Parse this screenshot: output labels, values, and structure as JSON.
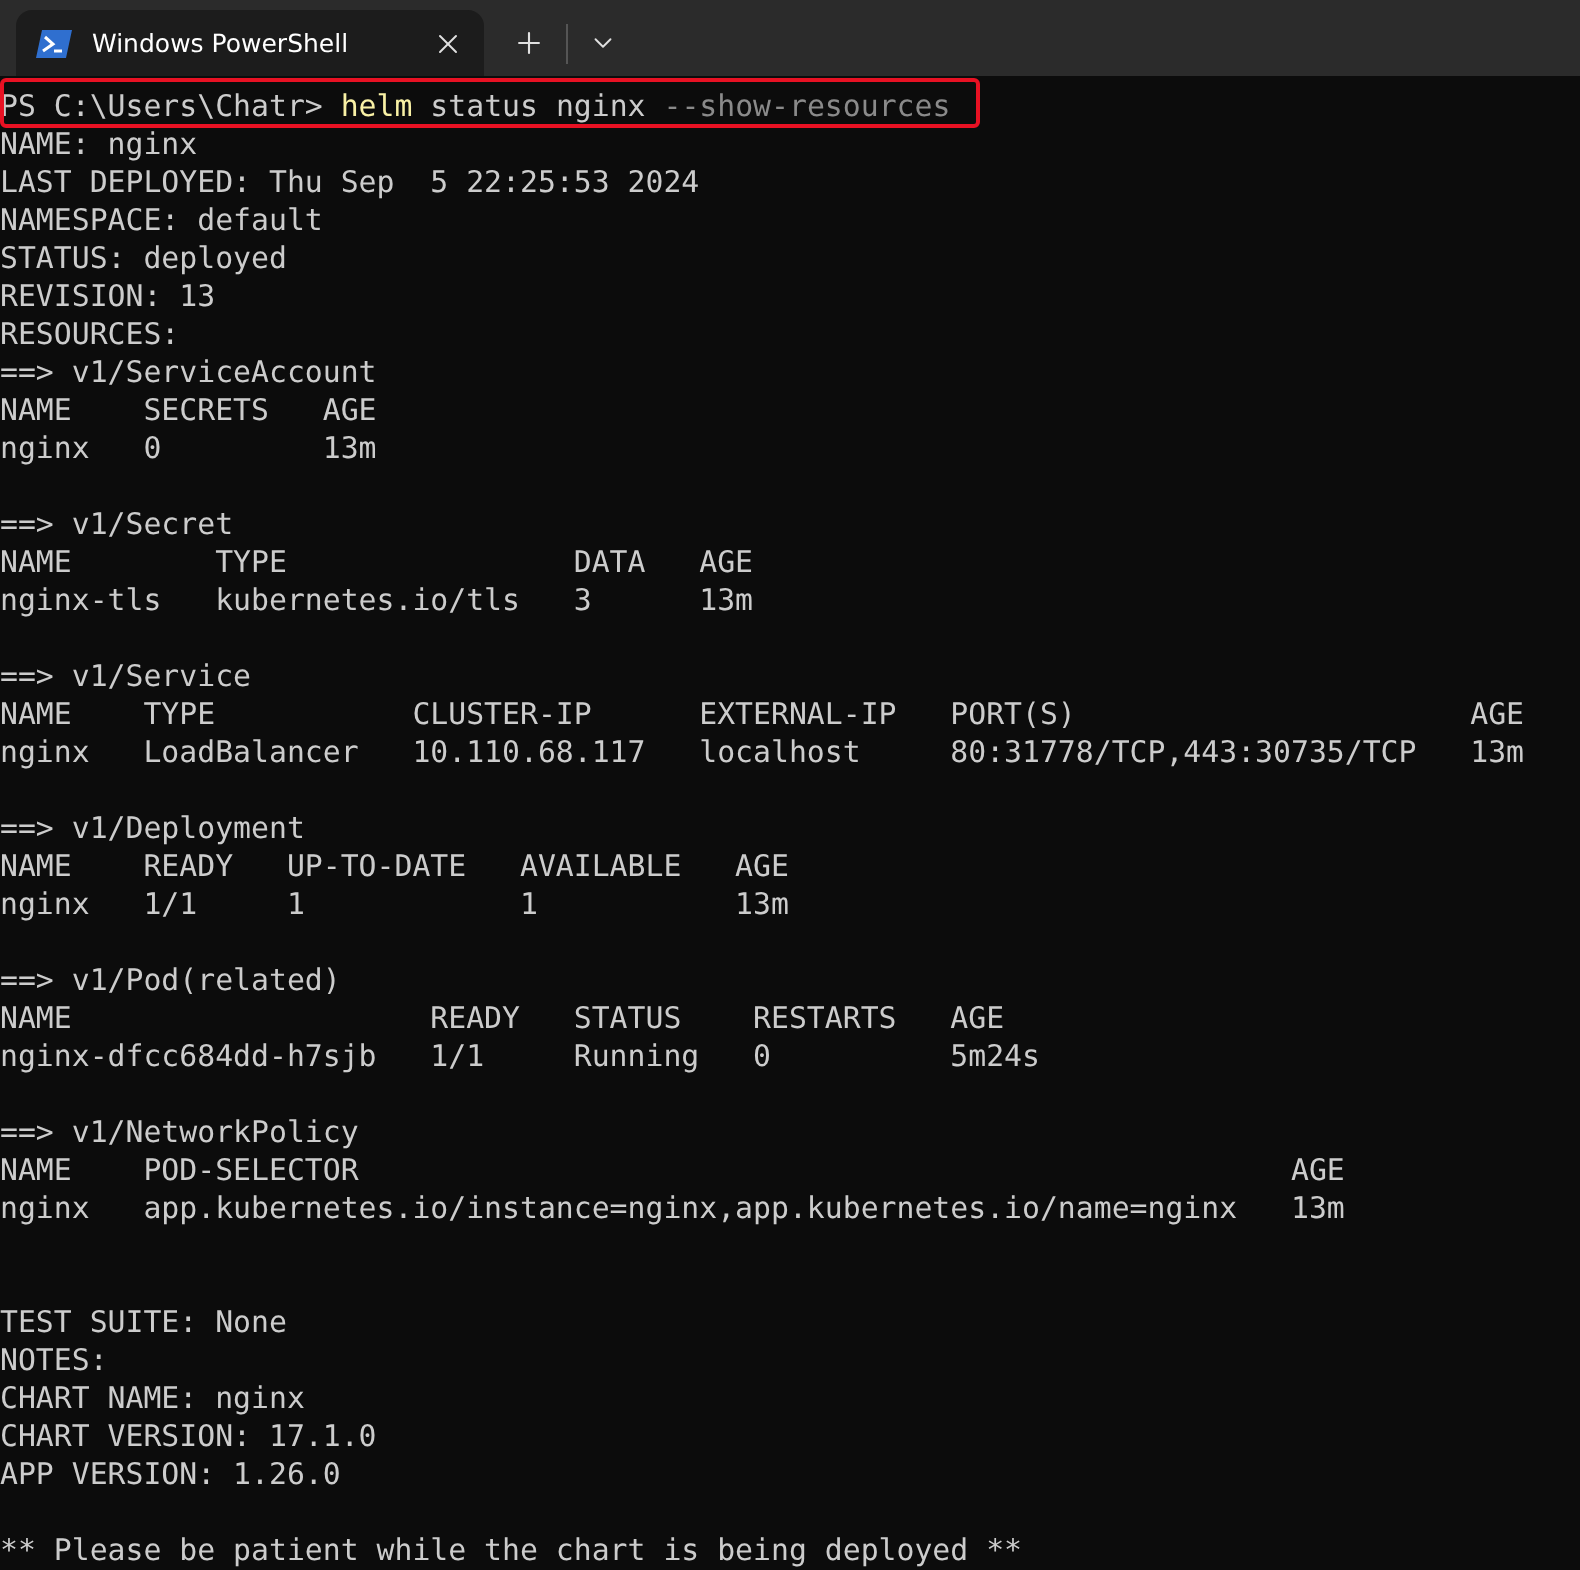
{
  "tab": {
    "title": "Windows PowerShell",
    "selected": true
  },
  "prompt": {
    "path": "PS C:\\Users\\Chatr>",
    "command": "helm",
    "args": "status nginx",
    "flag": "--show-resources",
    "highlighted": true
  },
  "output": [
    {
      "kind": "text",
      "text": "NAME: nginx"
    },
    {
      "kind": "text",
      "text": "LAST DEPLOYED: Thu Sep  5 22:25:53 2024"
    },
    {
      "kind": "text",
      "text": "NAMESPACE: default"
    },
    {
      "kind": "text",
      "text": "STATUS: deployed"
    },
    {
      "kind": "text",
      "text": "REVISION: 13"
    },
    {
      "kind": "text",
      "text": "RESOURCES:"
    },
    {
      "kind": "text",
      "text": "==> v1/ServiceAccount"
    },
    {
      "kind": "text",
      "text": "NAME    SECRETS   AGE"
    },
    {
      "kind": "text",
      "text": "nginx   0         13m"
    },
    {
      "kind": "blank"
    },
    {
      "kind": "text",
      "text": "==> v1/Secret"
    },
    {
      "kind": "text",
      "text": "NAME        TYPE                DATA   AGE"
    },
    {
      "kind": "text",
      "text": "nginx-tls   kubernetes.io/tls   3      13m"
    },
    {
      "kind": "blank"
    },
    {
      "kind": "text",
      "text": "==> v1/Service"
    },
    {
      "kind": "text",
      "text": "NAME    TYPE           CLUSTER-IP      EXTERNAL-IP   PORT(S)                      AGE"
    },
    {
      "kind": "text",
      "text": "nginx   LoadBalancer   10.110.68.117   localhost     80:31778/TCP,443:30735/TCP   13m"
    },
    {
      "kind": "blank"
    },
    {
      "kind": "text",
      "text": "==> v1/Deployment"
    },
    {
      "kind": "text",
      "text": "NAME    READY   UP-TO-DATE   AVAILABLE   AGE"
    },
    {
      "kind": "text",
      "text": "nginx   1/1     1            1           13m"
    },
    {
      "kind": "blank"
    },
    {
      "kind": "text",
      "text": "==> v1/Pod(related)"
    },
    {
      "kind": "text",
      "text": "NAME                    READY   STATUS    RESTARTS   AGE"
    },
    {
      "kind": "text",
      "text": "nginx-dfcc684dd-h7sjb   1/1     Running   0          5m24s"
    },
    {
      "kind": "blank"
    },
    {
      "kind": "text",
      "text": "==> v1/NetworkPolicy"
    },
    {
      "kind": "text",
      "text": "NAME    POD-SELECTOR                                                    AGE"
    },
    {
      "kind": "text",
      "text": "nginx   app.kubernetes.io/instance=nginx,app.kubernetes.io/name=nginx   13m"
    },
    {
      "kind": "blank"
    },
    {
      "kind": "blank"
    },
    {
      "kind": "text",
      "text": "TEST SUITE: None"
    },
    {
      "kind": "text",
      "text": "NOTES:"
    },
    {
      "kind": "text",
      "text": "CHART NAME: nginx"
    },
    {
      "kind": "text",
      "text": "CHART VERSION: 17.1.0"
    },
    {
      "kind": "text",
      "text": "APP VERSION: 1.26.0"
    },
    {
      "kind": "blank"
    },
    {
      "kind": "text",
      "text": "** Please be patient while the chart is being deployed **"
    }
  ]
}
